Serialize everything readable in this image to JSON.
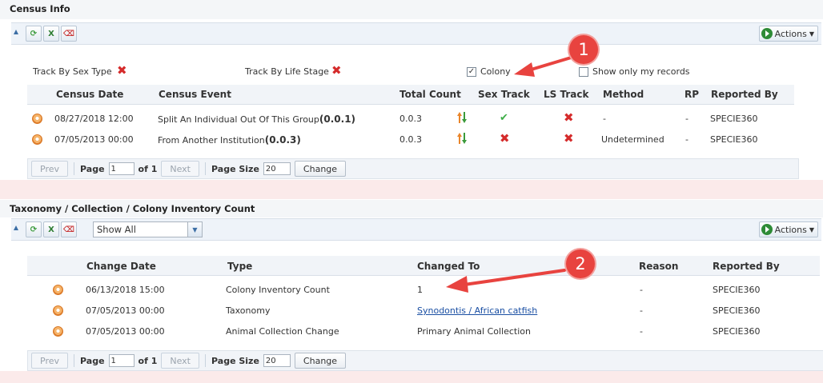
{
  "census": {
    "title": "Census Info",
    "actions_label": "Actions",
    "filters": {
      "track_sex": "Track By Sex Type",
      "track_life": "Track By Life Stage",
      "colony": "Colony",
      "colony_checked": true,
      "only_mine": "Show only my records"
    },
    "columns": [
      "Census Date",
      "Census Event",
      "Total Count",
      "Sex Track",
      "LS Track",
      "Method",
      "RP",
      "Reported By"
    ],
    "rows": [
      {
        "date": "08/27/2018 12:00",
        "event": "Split An Individual Out Of This Group",
        "event_count": "(0.0.1)",
        "total": "0.0.3",
        "sex_track": "check",
        "ls_track": "x",
        "method": "-",
        "rp": "-",
        "reported_by": "SPECIE360"
      },
      {
        "date": "07/05/2013 00:00",
        "event": "From Another Institution",
        "event_count": "(0.0.3)",
        "total": "0.0.3",
        "sex_track": "x",
        "ls_track": "x",
        "method": "Undetermined",
        "rp": "-",
        "reported_by": "SPECIE360"
      }
    ],
    "pager": {
      "prev": "Prev",
      "page": "Page",
      "page_value": "1",
      "of": "of 1",
      "next": "Next",
      "page_size": "Page Size",
      "size_value": "20",
      "change": "Change"
    }
  },
  "inventory": {
    "title": "Taxonomy / Collection / Colony Inventory Count",
    "filter_value": "Show All",
    "actions_label": "Actions",
    "columns": [
      "Change Date",
      "Type",
      "Changed To",
      "Reason",
      "Reported By"
    ],
    "rows": [
      {
        "date": "06/13/2018 15:00",
        "type": "Colony Inventory Count",
        "changed_to": "1",
        "reason": "-",
        "reported_by": "SPECIE360"
      },
      {
        "date": "07/05/2013 00:00",
        "type": "Taxonomy",
        "changed_to": "Synodontis / African catfish",
        "reason": "-",
        "reported_by": "SPECIE360"
      },
      {
        "date": "07/05/2013 00:00",
        "type": "Animal Collection Change",
        "changed_to": "Primary Animal Collection",
        "reason": "-",
        "reported_by": "SPECIE360"
      }
    ],
    "pager": {
      "prev": "Prev",
      "page": "Page",
      "page_value": "1",
      "of": "of 1",
      "next": "Next",
      "page_size": "Page Size",
      "size_value": "20",
      "change": "Change"
    }
  },
  "annotations": {
    "badge1": "1",
    "badge2": "2"
  },
  "colors": {
    "band": "#fbeaea",
    "header_bg": "#eef3f9",
    "annotation": "#e8433f"
  },
  "icons": [
    "refresh-icon",
    "excel-icon",
    "pdf-icon",
    "actions-play-icon",
    "remove-x-icon",
    "check-icon",
    "sort-arrows-icon",
    "row-detail-icon",
    "dropdown-caret-icon"
  ]
}
